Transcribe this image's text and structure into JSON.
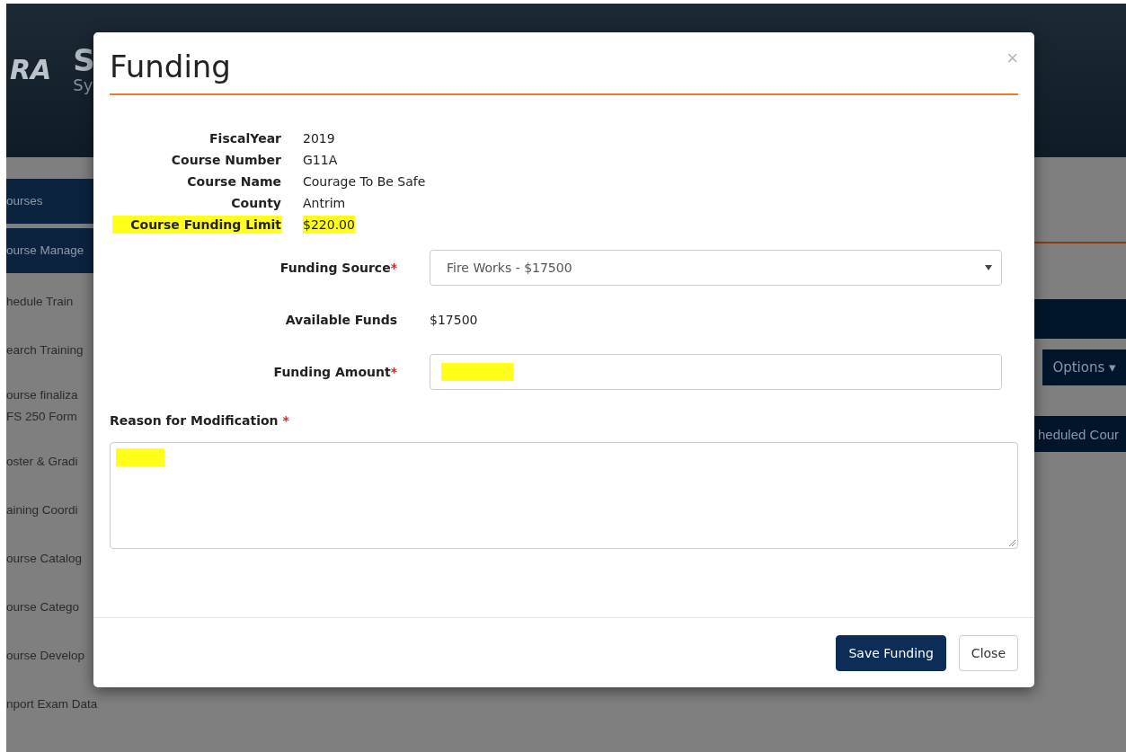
{
  "header": {
    "logo": "RA",
    "title": "S",
    "subtitle": "Sy"
  },
  "sidebar": {
    "items": [
      {
        "label": "ourses",
        "selected": true
      },
      {
        "label": "ourse Manage",
        "selected": true
      },
      {
        "label": "hedule Train",
        "selected": false
      },
      {
        "label": "earch Training",
        "selected": false
      },
      {
        "label": "ourse finaliza",
        "sublabel": "FS 250 Form",
        "selected": false
      },
      {
        "label": "oster & Gradi",
        "selected": false
      },
      {
        "label": "aining Coordi",
        "selected": false
      },
      {
        "label": "ourse Catalog",
        "selected": false
      },
      {
        "label": "ourse Catego",
        "selected": false
      },
      {
        "label": "ourse Develop",
        "selected": false
      },
      {
        "label": "nport Exam Data",
        "selected": false
      }
    ]
  },
  "background_content": {
    "options_button": "Options ▾",
    "scheduled_button": "heduled Cour"
  },
  "dialog": {
    "title": "Funding",
    "close": "×",
    "required_marker": "*",
    "details": [
      {
        "label": "FiscalYear",
        "value": "2019",
        "highlighted": false
      },
      {
        "label": "Course Number",
        "value": "G11A",
        "highlighted": false
      },
      {
        "label": "Course Name",
        "value": "Courage To Be Safe",
        "highlighted": false
      },
      {
        "label": "County",
        "value": "Antrim",
        "highlighted": false
      },
      {
        "label": "Course Funding Limit",
        "value": "$220.00",
        "highlighted": true
      }
    ],
    "fields": [
      {
        "kind": "select",
        "label": "Funding Source",
        "required": true,
        "value": "Fire Works - $17500"
      },
      {
        "kind": "text",
        "label": "Available Funds",
        "value": "$17500"
      },
      {
        "kind": "input",
        "label": "Funding Amount",
        "required": true,
        "highlighted": true
      }
    ],
    "reason": {
      "label": "Reason for Modification",
      "required": true,
      "highlighted": true
    },
    "buttons": [
      {
        "label": "Save Funding",
        "kind": "primary"
      },
      {
        "label": "Close",
        "kind": "default"
      }
    ]
  }
}
